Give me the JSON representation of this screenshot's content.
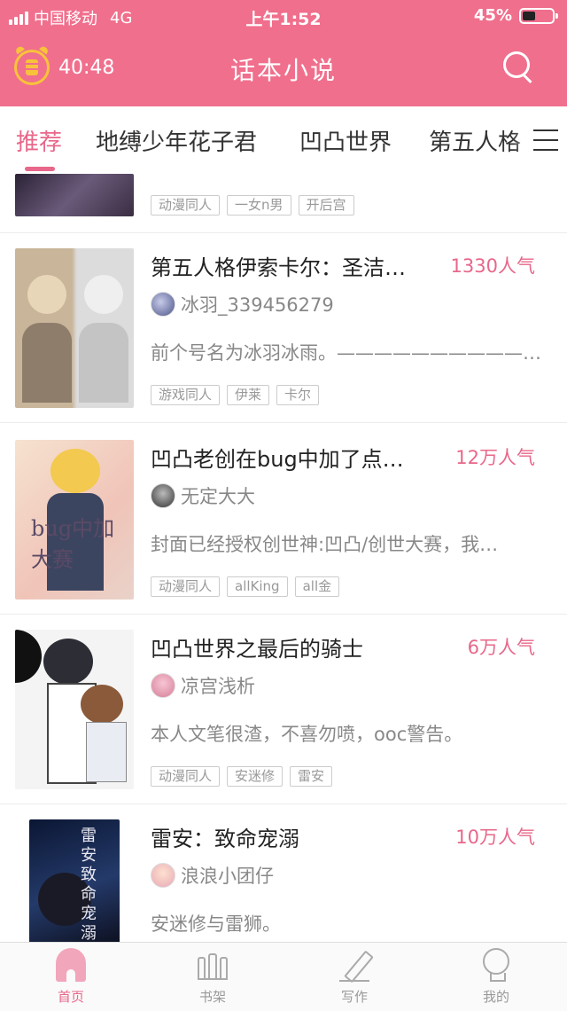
{
  "status_bar": {
    "carrier": "中国移动",
    "network": "4G",
    "time": "上午1:52",
    "battery": "45%",
    "battery_level": 0.45
  },
  "header": {
    "timer": "40:48",
    "title": "话本小说",
    "accent": "#f06f8d"
  },
  "tabs": [
    {
      "label": "推荐",
      "active": true
    },
    {
      "label": "地缚少年花子君"
    },
    {
      "label": "凹凸世界"
    },
    {
      "label": "第五人格"
    }
  ],
  "feed": [
    {
      "title": "",
      "popularity": "",
      "author": "",
      "description": "",
      "tags": [
        "动漫同人",
        "一女n男",
        "开后宫"
      ]
    },
    {
      "title": "第五人格伊索卡尔：圣洁…",
      "popularity": "1330人气",
      "author": "冰羽_339456279",
      "description": "前个号名为冰羽冰雨。———————————…",
      "tags": [
        "游戏同人",
        "伊莱",
        "卡尔"
      ]
    },
    {
      "title": "凹凸老创在bug中加了点…",
      "popularity": "12万人气",
      "author": "无定大大",
      "description": "封面已经授权创世神:凹凸/创世大赛，我…",
      "tags": [
        "动漫同人",
        "allKing",
        "all金"
      ],
      "cover_text": "bug中加大赛"
    },
    {
      "title": "凹凸世界之最后的骑士",
      "popularity": "6万人气",
      "author": "凉宫浅析",
      "description": "本人文笔很渣，不喜勿喷，ooc警告。",
      "tags": [
        "动漫同人",
        "安迷修",
        "雷安"
      ]
    },
    {
      "title": "雷安：致命宠溺",
      "popularity": "10万人气",
      "author": "浪浪小团仔",
      "description": "安迷修与雷狮。",
      "tags": [],
      "cover_text": "雷安致命宠溺"
    }
  ],
  "bottom_nav": [
    {
      "label": "首页",
      "icon": "home-icon",
      "active": true
    },
    {
      "label": "书架",
      "icon": "bookshelf-icon"
    },
    {
      "label": "写作",
      "icon": "pen-icon"
    },
    {
      "label": "我的",
      "icon": "profile-icon"
    }
  ]
}
